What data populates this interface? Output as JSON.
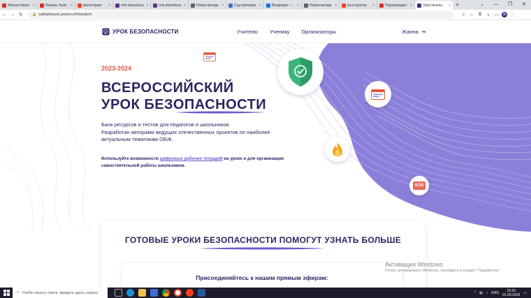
{
  "browser": {
    "tabs": [
      {
        "label": "Жанна Никол",
        "color": "#d93025"
      },
      {
        "label": "Физика. Базо",
        "color": "#d93025"
      },
      {
        "label": "мониторинг",
        "color": "#fc3f1d"
      },
      {
        "label": "rmk.staveduca",
        "color": "#5f368a"
      },
      {
        "label": "rmk.staveduca",
        "color": "#5f368a"
      },
      {
        "label": "Новая вкладк",
        "color": "#5f6368"
      },
      {
        "label": "Суд приговор",
        "color": "#4a6fbf"
      },
      {
        "label": "Входящие —",
        "color": "#1a73e8"
      },
      {
        "label": "Новая вкладк",
        "color": "#5f6368"
      },
      {
        "label": "конструктор",
        "color": "#fc3f1d"
      },
      {
        "label": "Подтвержден",
        "color": "#d93025"
      },
      {
        "label": "Урок безопа",
        "color": "#3b2e7e",
        "active": true
      }
    ],
    "new_tab": "+",
    "window_controls": [
      "⌄",
      "—",
      "❐",
      "✕"
    ],
    "nav": {
      "back": "←",
      "forward": "→",
      "reload": "↻"
    },
    "url": "safetylesson.prosv.ru/#/student",
    "lock": "🔒",
    "toolbar_icons": [
      "↗",
      "☆",
      "⧉",
      "⤓",
      "▭"
    ],
    "profile_initial": "Ж",
    "menu": "⋮"
  },
  "site": {
    "logo_text": "УРОК БЕЗОПАСНОСТИ",
    "logo_icon": "shield-check-icon",
    "nav": [
      "Учителю",
      "Ученику",
      "Организаторы"
    ],
    "user_name": "Жанна",
    "logout_icon": "⇥",
    "colors": {
      "brand": "#2b2560",
      "accent": "#e0563a",
      "purple": "#8b80d9",
      "green": "#3cb57c"
    }
  },
  "hero": {
    "year": "2023-2024",
    "title_line1": "ВСЕРОССИЙСКИЙ",
    "title_line2": "УРОК БЕЗОПАСНОСТИ",
    "desc_line1": "Банк ресурсов и тестов для педагогов и школьников.",
    "desc_line2": "Разработан авторами ведущих отечественных проектов по наиболее",
    "desc_line3": "актуальным тематикам ОБЖ.",
    "note_pre": "Используйте возможности ",
    "note_link": "цифровых рабочих тетрадей",
    "note_post": " на уроке и для организации",
    "note_line2": "самостоятельной работы школьников.",
    "sos_label": "SOS"
  },
  "card": {
    "title": "ГОТОВЫЕ УРОКИ БЕЗОПАСНОСТИ ПОМОГУТ УЗНАТЬ БОЛЬШЕ",
    "inner_title": "Присоединяйтесь к нашим прямым эфирам:"
  },
  "windows": {
    "activate_title": "Активация Windows",
    "activate_sub": "Чтобы активировать Windows, перейдите в раздел \"Параметры\".",
    "search_placeholder": "Чтобы начать поиск, введите здесь запрос",
    "tray_text": "ENG",
    "time": "15:20",
    "date": "01.09.2023"
  }
}
